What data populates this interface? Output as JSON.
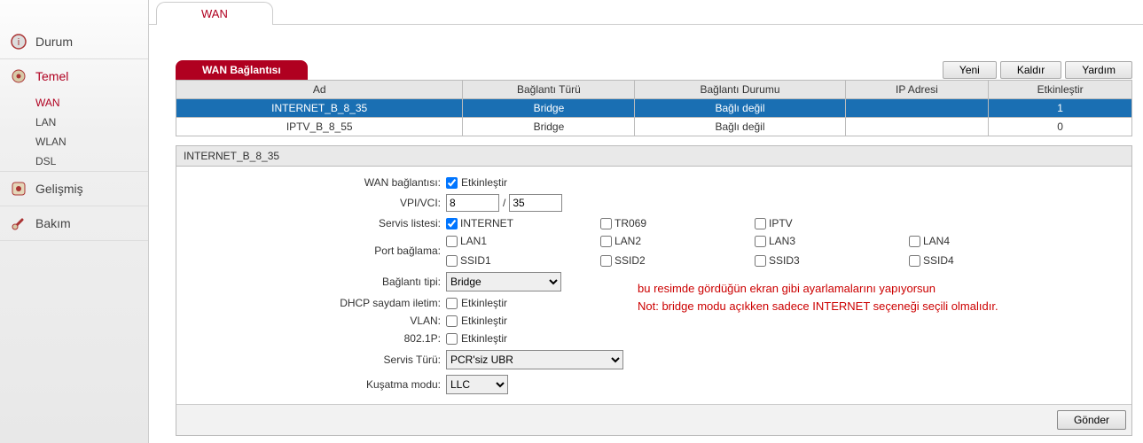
{
  "sidebar": {
    "items": [
      {
        "label": "Durum",
        "icon": "status-icon"
      },
      {
        "label": "Temel",
        "icon": "gear-icon",
        "active": true,
        "subs": [
          {
            "label": "WAN",
            "active": true
          },
          {
            "label": "LAN"
          },
          {
            "label": "WLAN"
          },
          {
            "label": "DSL"
          }
        ]
      },
      {
        "label": "Gelişmiş",
        "icon": "advanced-icon"
      },
      {
        "label": "Bakım",
        "icon": "maintenance-icon"
      }
    ]
  },
  "tab": {
    "label": "WAN"
  },
  "section": {
    "title": "WAN Bağlantısı"
  },
  "top_buttons": {
    "new": "Yeni",
    "remove": "Kaldır",
    "help": "Yardım"
  },
  "table": {
    "headers": {
      "name": "Ad",
      "type": "Bağlantı Türü",
      "status": "Bağlantı Durumu",
      "ip": "IP Adresi",
      "enable": "Etkinleştir"
    },
    "rows": [
      {
        "name": "INTERNET_B_8_35",
        "type": "Bridge",
        "status": "Bağlı değil",
        "ip": "",
        "enable": "1",
        "selected": true
      },
      {
        "name": "IPTV_B_8_55",
        "type": "Bridge",
        "status": "Bağlı değil",
        "ip": "",
        "enable": "0",
        "selected": false
      }
    ]
  },
  "panel": {
    "title": "INTERNET_B_8_35",
    "labels": {
      "wan_conn": "WAN bağlantısı:",
      "vpi_vci": "VPI/VCI:",
      "service_list": "Servis listesi:",
      "port_bind": "Port bağlama:",
      "conn_type": "Bağlantı tipi:",
      "dhcp": "DHCP saydam iletim:",
      "vlan": "VLAN:",
      "p8021": "802.1P:",
      "service_type": "Servis Türü:",
      "encap": "Kuşatma modu:"
    },
    "values": {
      "enable_label": "Etkinleştir",
      "vpi": "8",
      "vci": "35",
      "vpi_vci_sep": "/",
      "services": {
        "internet": "INTERNET",
        "tr069": "TR069",
        "iptv": "IPTV"
      },
      "ports": {
        "lan1": "LAN1",
        "lan2": "LAN2",
        "lan3": "LAN3",
        "lan4": "LAN4",
        "ssid1": "SSID1",
        "ssid2": "SSID2",
        "ssid3": "SSID3",
        "ssid4": "SSID4"
      },
      "conn_type_value": "Bridge",
      "service_type_value": "PCR'siz UBR",
      "encap_value": "LLC"
    },
    "note": {
      "line1": "bu resimde gördüğün ekran gibi ayarlamalarını yapıyorsun",
      "line2": "Not: bridge modu açıkken sadece  INTERNET seçeneği seçili olmalıdır."
    },
    "submit": "Gönder"
  }
}
